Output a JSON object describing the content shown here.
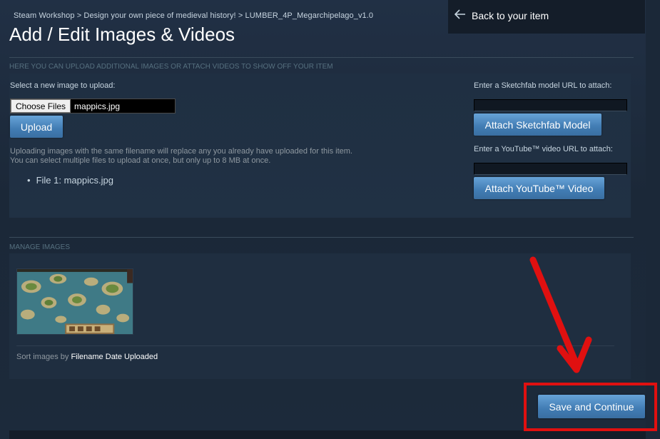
{
  "breadcrumb": "Steam Workshop > Design your own piece of medieval history! > LUMBER_4P_Megarchipelago_v1.0",
  "page_title": "Add / Edit Images & Videos",
  "back_link": {
    "label": "Back to your item",
    "icon": "back-arrow-icon"
  },
  "upload_section": {
    "header": "HERE YOU CAN UPLOAD ADDITIONAL IMAGES OR ATTACH VIDEOS TO SHOW OFF YOUR ITEM",
    "select_label": "Select a new image to upload:",
    "choose_files_label": "Choose Files",
    "selected_file": "mappics.jpg",
    "upload_button": "Upload",
    "note_line1": "Uploading images with the same filename will replace any you already have uploaded for this item.",
    "note_line2": "You can select multiple files to upload at once, but only up to 8 MB at once.",
    "files": [
      "File 1: mappics.jpg"
    ]
  },
  "attach_section": {
    "sketchfab_label": "Enter a Sketchfab model URL to attach:",
    "sketchfab_value": "",
    "sketchfab_button": "Attach Sketchfab Model",
    "youtube_label": "Enter a YouTube™ video URL to attach:",
    "youtube_value": "",
    "youtube_button": "Attach YouTube™ Video"
  },
  "manage_section": {
    "header": "MANAGE IMAGES",
    "sort_prefix": "Sort images by",
    "sort_options": [
      "Filename",
      "Date Uploaded"
    ]
  },
  "footer": {
    "save_button": "Save and Continue"
  },
  "colors": {
    "background": "#1b2838",
    "button_blue": "#417cb3",
    "annotation_red": "#e01010",
    "text_light": "#c7d5e0"
  }
}
